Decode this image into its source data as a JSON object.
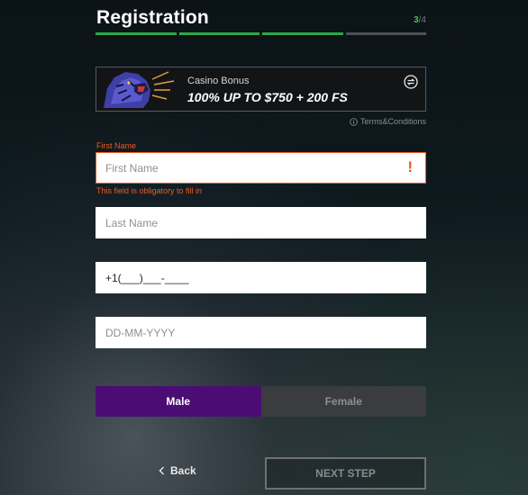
{
  "header": {
    "title": "Registration",
    "step_current": "3",
    "step_total": "/4",
    "progress": {
      "completed_steps": 3,
      "total_steps": 4
    }
  },
  "bonus": {
    "label": "Casino Bonus",
    "value": "100% UP TO $750 + 200 FS",
    "image_icon": "tiger-icon",
    "change_icon": "swap-icon"
  },
  "terms": {
    "label": "Terms&Conditions",
    "icon": "info-icon"
  },
  "form": {
    "first_name": {
      "label": "First Name",
      "placeholder": "First Name",
      "value": "",
      "error_mark": "!",
      "error_text": "This field is obligatory to fill in"
    },
    "last_name": {
      "placeholder": "Last Name",
      "value": ""
    },
    "phone": {
      "placeholder": "+1(___)___-____",
      "value": "+1(___)___-____"
    },
    "birthdate": {
      "placeholder": "DD-MM-YYYY",
      "value": ""
    }
  },
  "gender": {
    "options": [
      "Male",
      "Female"
    ],
    "selected": "Male"
  },
  "nav": {
    "back_label": "Back",
    "next_label": "NEXT STEP"
  },
  "colors": {
    "accent_green": "#2aa84a",
    "error": "#f15a22",
    "selected_purple": "#4b0d74"
  }
}
